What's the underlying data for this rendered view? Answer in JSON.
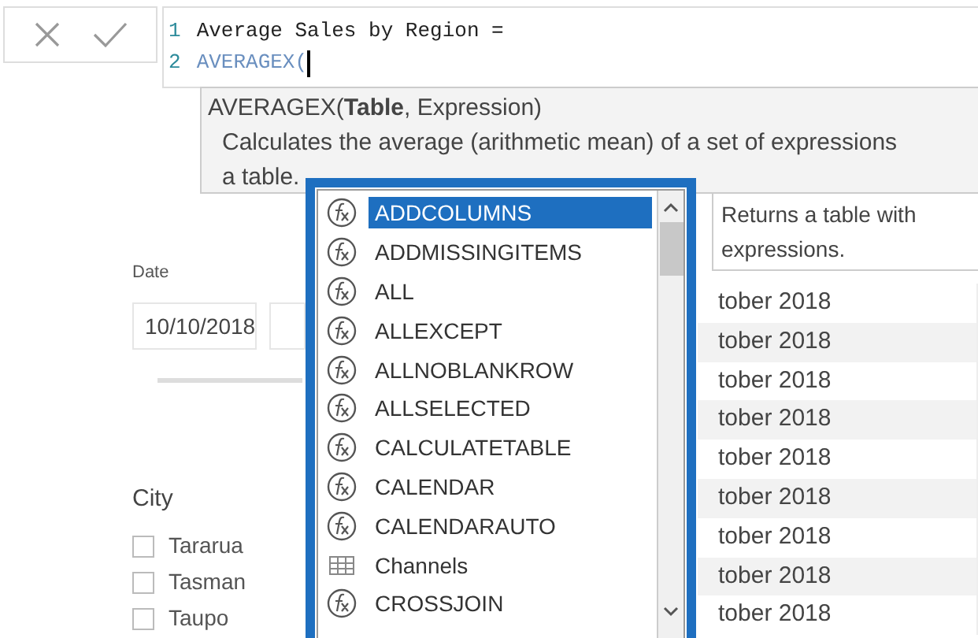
{
  "formula_lines": [
    {
      "number": "1",
      "code": "Average Sales by Region =",
      "kind": "plain"
    },
    {
      "number": "2",
      "code": "AVERAGEX(",
      "kind": "function"
    }
  ],
  "tooltip": {
    "signature": "AVERAGEX(**Table**, Expression)",
    "description": "Calculates the average (arithmetic mean) of a set of expressions",
    "description_end": "a table."
  },
  "suggestions": [
    {
      "label": "ADDCOLUMNS",
      "kind": "function",
      "selected": true
    },
    {
      "label": "ADDMISSINGITEMS",
      "kind": "function",
      "selected": false
    },
    {
      "label": "ALL",
      "kind": "function",
      "selected": false
    },
    {
      "label": "ALLEXCEPT",
      "kind": "function",
      "selected": false
    },
    {
      "label": "ALLNOBLANKROW",
      "kind": "function",
      "selected": false
    },
    {
      "label": "ALLSELECTED",
      "kind": "function",
      "selected": false
    },
    {
      "label": "CALCULATETABLE",
      "kind": "function",
      "selected": false
    },
    {
      "label": "CALENDAR",
      "kind": "function",
      "selected": false
    },
    {
      "label": "CALENDARAUTO",
      "kind": "function",
      "selected": false
    },
    {
      "label": "Channels",
      "kind": "table",
      "selected": false
    },
    {
      "label": "CROSSJOIN",
      "kind": "function",
      "selected": false
    }
  ],
  "suggestion_help": [
    "Returns a table with",
    "expressions."
  ],
  "table_rows": [
    "tober 2018",
    "tober 2018",
    "tober 2018",
    "tober 2018",
    "tober 2018",
    "tober 2018",
    "tober 2018",
    "tober 2018",
    "tober 2018"
  ],
  "date_filter": {
    "label": "Date",
    "start": "10/10/2018"
  },
  "city_slicer": {
    "title": "City",
    "items": [
      {
        "label": "Tararua",
        "checked": false
      },
      {
        "label": "Tasman",
        "checked": false
      },
      {
        "label": "Taupo",
        "checked": false
      }
    ]
  }
}
